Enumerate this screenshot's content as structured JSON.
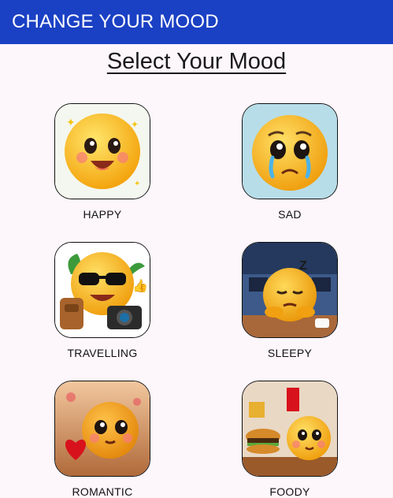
{
  "appbar": {
    "title": "CHANGE YOUR MOOD"
  },
  "page": {
    "heading": "Select Your Mood"
  },
  "moods": [
    {
      "label": "HAPPY",
      "icon": "happy-emoji-icon"
    },
    {
      "label": "SAD",
      "icon": "sad-emoji-icon"
    },
    {
      "label": "TRAVELLING",
      "icon": "travelling-emoji-icon"
    },
    {
      "label": "SLEEPY",
      "icon": "sleepy-emoji-icon"
    },
    {
      "label": "ROMANTIC",
      "icon": "romantic-emoji-icon"
    },
    {
      "label": "FOODY",
      "icon": "foody-emoji-icon"
    }
  ],
  "colors": {
    "appbar": "#1a40c4",
    "background": "#fdf6fb",
    "emoji": "#f8b820"
  }
}
